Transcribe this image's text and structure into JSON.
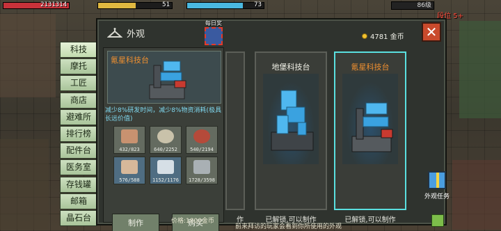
{
  "hud": {
    "hp": "2131314",
    "food": "51",
    "water": "73",
    "level": "86级",
    "rank": "段位 5+"
  },
  "panel": {
    "title": "外观",
    "coins": "4781 金币",
    "close": "✕",
    "daily_label": "每日奖"
  },
  "menu": [
    "科技",
    "摩托",
    "工匠",
    "商店",
    "避难所",
    "排行榜",
    "配件台",
    "医务室",
    "存钱罐",
    "邮箱",
    "晶石台"
  ],
  "detail": {
    "name": "氪星科技台",
    "description": "减少8%研发时间，减少8%物资消耗(极具长远价值)",
    "materials": [
      {
        "count": "432/823",
        "icon": "wood-plank-icon",
        "color": "#c89270",
        "rare": false
      },
      {
        "count": "640/2252",
        "icon": "metal-nut-icon",
        "color": "#c9c2aa",
        "rare": false
      },
      {
        "count": "540/2194",
        "icon": "wire-icon",
        "color": "#b54a3a",
        "rare": false
      },
      {
        "count": "576/588",
        "icon": "cardboard-box-icon",
        "color": "#d7b89a",
        "rare": true
      },
      {
        "count": "1152/1176",
        "icon": "cloth-bag-icon",
        "color": "#d6dfe6",
        "rare": true
      },
      {
        "count": "1728/3598",
        "icon": "stone-icon",
        "color": "#a9b0b4",
        "rare": false
      }
    ],
    "craft_label": "制作",
    "buy_label": "购买",
    "price": "价格:1800金币"
  },
  "cards": [
    {
      "name": "",
      "status": "作",
      "name_color": "#f2f2e8"
    },
    {
      "name": "地堡科技台",
      "status": "已解锁,可以制作",
      "name_color": "#f2f2e8"
    },
    {
      "name": "氪星科技台",
      "status": "已解锁,可以制作",
      "name_color": "#f09030"
    }
  ],
  "footer_note": "前来拜访的玩家会看到你所使用的外观",
  "gift_label": "外观任务",
  "colors": {
    "accent_select": "#5ae0e0",
    "title_orange": "#f09030",
    "desc_cyan": "#7fd8f0"
  }
}
